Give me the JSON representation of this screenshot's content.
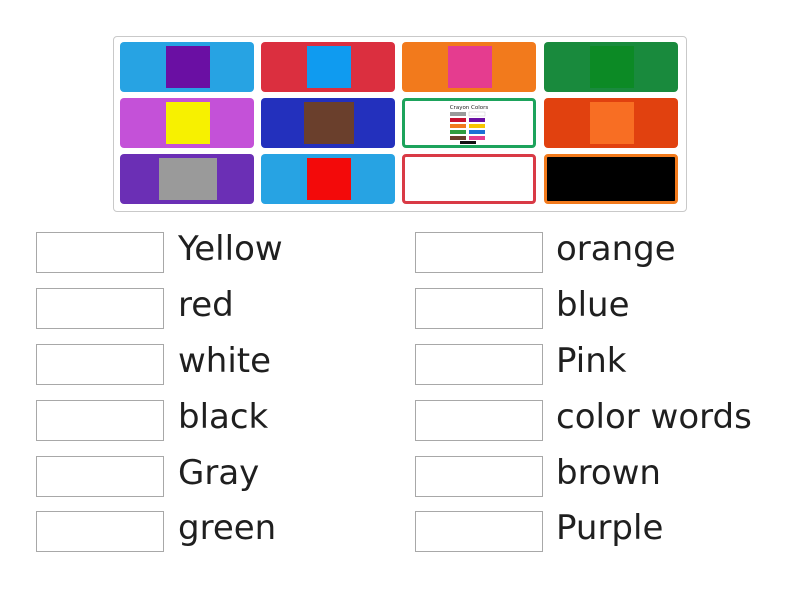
{
  "grid": {
    "tiles": [
      {
        "bg": "#27a3e3",
        "swatch": "#6a0fa3"
      },
      {
        "bg": "#db2f3f",
        "swatch": "#0f9bf0"
      },
      {
        "bg": "#f27a1c",
        "swatch": "#e53c8f"
      },
      {
        "bg": "#198a3d",
        "swatch": "#0c8a25"
      },
      {
        "bg": "#c451d8",
        "swatch": "#f7f100"
      },
      {
        "bg": "#2330bd",
        "swatch": "#6a3f2c"
      },
      {
        "bg": "#ffffff",
        "border": "#1da35c",
        "thumbnail": "Crayon Colors"
      },
      {
        "bg": "#e1410f",
        "swatch": "#f86e23"
      },
      {
        "bg": "#6b2fb5",
        "swatch": "#9a9a9a"
      },
      {
        "bg": "#27a3e3",
        "swatch": "#f30a0a"
      },
      {
        "bg": "#ffffff",
        "border": "#d93a46",
        "swatch": "#ffffff"
      },
      {
        "bg": "#000000",
        "border": "#f27a1c",
        "swatch": "#000000"
      }
    ]
  },
  "answers": {
    "left": [
      "Yellow",
      "red",
      "white",
      "black",
      "Gray",
      "green"
    ],
    "right": [
      "orange",
      "blue",
      "Pink",
      "color words",
      "brown",
      "Purple"
    ]
  }
}
